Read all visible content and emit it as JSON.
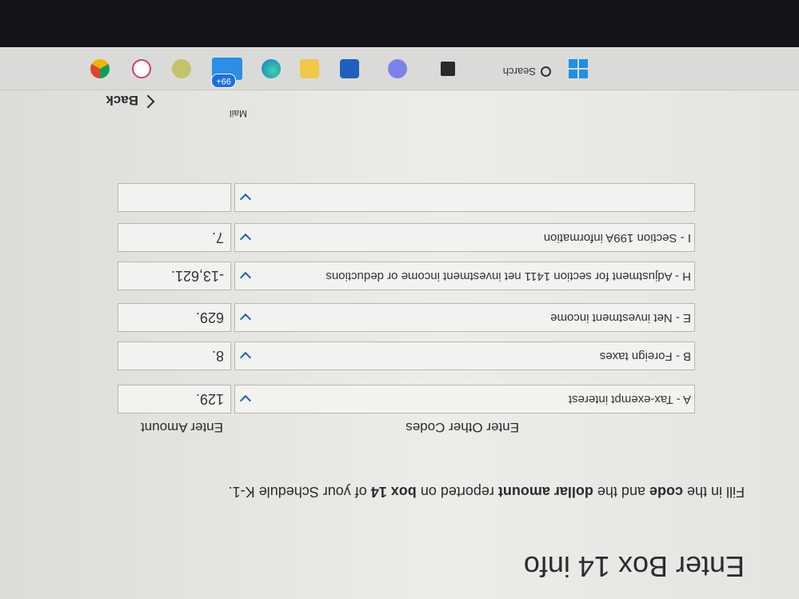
{
  "page": {
    "title": "Enter Box 14 info",
    "instructions": {
      "t1": "Fill in the ",
      "b1": "code",
      "t2": " and the ",
      "b2": "dollar amount",
      "t3": " reported on ",
      "b3": "box 14",
      "t4": " of your Schedule K-1."
    },
    "column_codes": "Enter Other Codes",
    "column_amount": "Enter Amount"
  },
  "rows": [
    {
      "code": "A - Tax-exempt interest",
      "amount": "129."
    },
    {
      "code": "B - Foreign taxes",
      "amount": "8."
    },
    {
      "code": "E - Net investment income",
      "amount": "629."
    },
    {
      "code": "H - Adjustment for section 1411 net investment income or deductions",
      "amount": "-13,621."
    },
    {
      "code": "I - Section 199A information",
      "amount": "7."
    },
    {
      "code": "",
      "amount": ""
    }
  ],
  "nav": {
    "back_label": "Back"
  },
  "taskbar": {
    "search_label": "Search",
    "mail_badge": "99+",
    "mail_label": "Mail"
  },
  "colors": {
    "accent": "#1f5fbf",
    "background": "#e8e8e6",
    "text": "#2b2c30"
  },
  "icons": [
    "windows-start-icon",
    "search-icon",
    "task-view-icon",
    "teams-icon",
    "store-icon",
    "file-explorer-icon",
    "edge-icon",
    "mail-icon",
    "app-icon",
    "slack-icon",
    "chrome-icon",
    "chevron-down-icon",
    "back-chevron-icon"
  ]
}
